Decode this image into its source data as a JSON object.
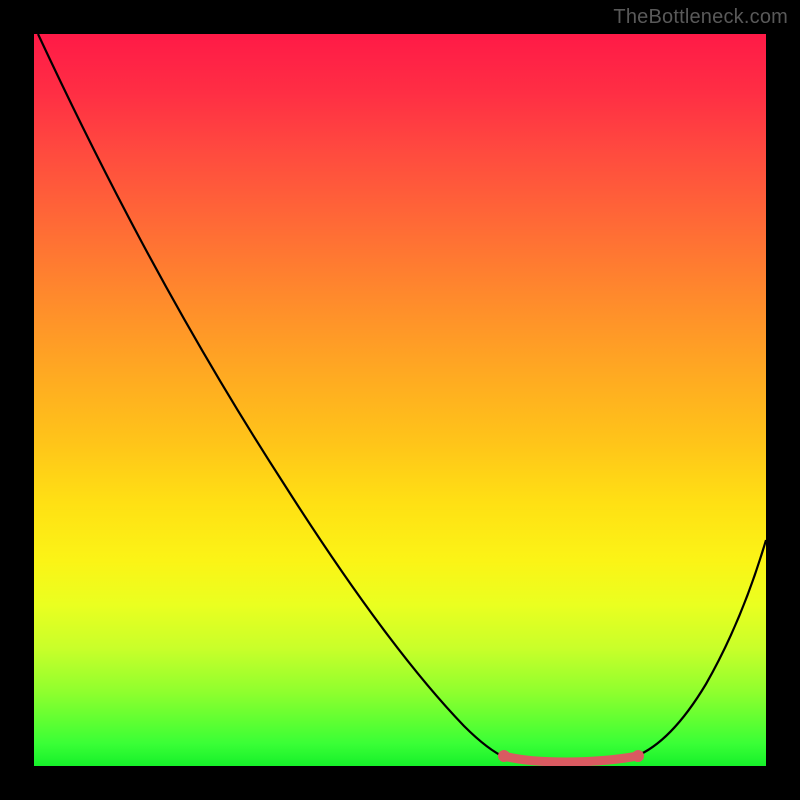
{
  "watermark": "TheBottleneck.com",
  "chart_data": {
    "type": "line",
    "title": "",
    "xlabel": "",
    "ylabel": "",
    "xlim": [
      0,
      100
    ],
    "ylim": [
      0,
      100
    ],
    "series": [
      {
        "name": "bottleneck-curve",
        "x": [
          0,
          6,
          12,
          18,
          24,
          30,
          36,
          42,
          48,
          54,
          58,
          62,
          66,
          70,
          74,
          78,
          82,
          86,
          90,
          94,
          100
        ],
        "y": [
          100,
          93,
          85,
          77,
          68,
          59,
          50,
          41,
          32,
          23,
          16,
          10,
          6,
          3,
          2,
          2,
          3,
          6,
          12,
          22,
          42
        ]
      }
    ],
    "annotations": [
      {
        "name": "optimal-range",
        "x_start": 62,
        "x_end": 84,
        "style": "highlight-segment"
      }
    ],
    "background_gradient": {
      "direction": "vertical",
      "stops": [
        {
          "pos": 0.0,
          "color": "#ff1a47"
        },
        {
          "pos": 0.5,
          "color": "#ffc519"
        },
        {
          "pos": 0.78,
          "color": "#eaff20"
        },
        {
          "pos": 1.0,
          "color": "#16f02a"
        }
      ]
    }
  }
}
